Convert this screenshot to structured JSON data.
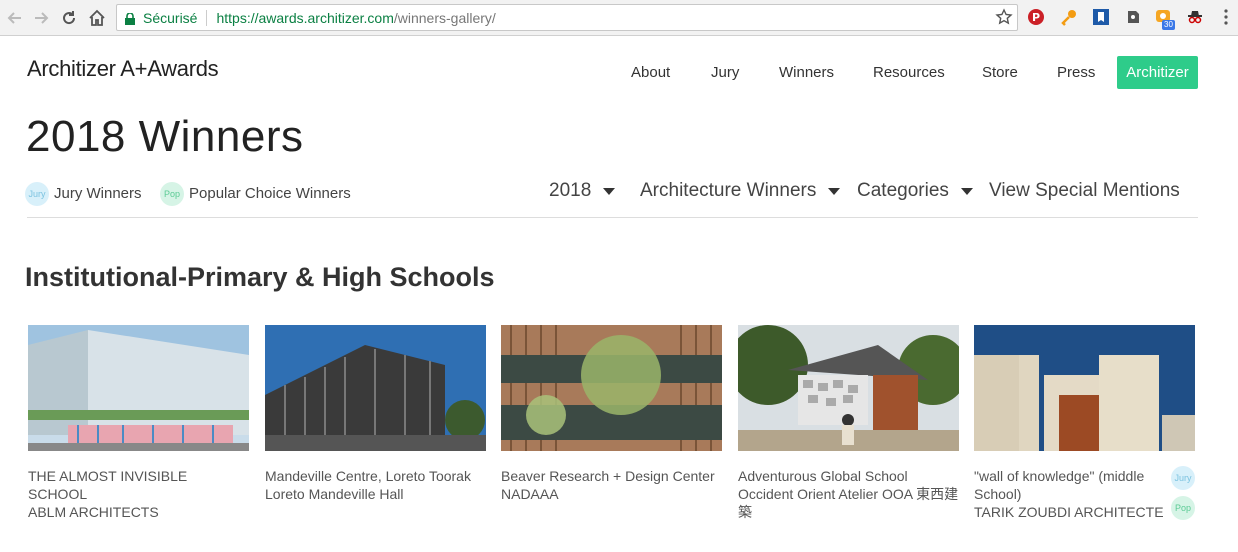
{
  "browser": {
    "secure_label": "Sécurisé",
    "url_host": "https://awards.architizer.com",
    "url_path": "/winners-gallery/",
    "ext_badge_count": "30"
  },
  "site": {
    "logo": "Architizer A+Awards",
    "nav": [
      "About",
      "Jury",
      "Winners",
      "Resources",
      "Store",
      "Press"
    ],
    "cta": "Architizer"
  },
  "page": {
    "title": "2018 Winners",
    "legend": {
      "jury_badge": "Jury",
      "jury_label": "Jury Winners",
      "pop_badge": "Pop",
      "pop_label": "Popular Choice Winners"
    },
    "filters": {
      "year": "2018",
      "type": "Architecture Winners",
      "categories": "Categories",
      "special": "View Special Mentions"
    },
    "section_title": "Institutional-Primary & High Schools"
  },
  "cards": [
    {
      "title": "THE ALMOST INVISIBLE SCHOOL",
      "firm": "ABLM ARCHITECTS"
    },
    {
      "title": "Mandeville Centre, Loreto Toorak",
      "firm": "Loreto Mandeville Hall"
    },
    {
      "title": "Beaver Research + Design Center",
      "firm": "NADAAA"
    },
    {
      "title": "Adventurous Global School",
      "firm": "Occident Orient Atelier OOA 東西建築"
    },
    {
      "title": "\"wall of knowledge\" (middle School)",
      "firm": "TARIK ZOUBDI ARCHITECTE",
      "badges": [
        "Jury",
        "Pop"
      ]
    }
  ]
}
